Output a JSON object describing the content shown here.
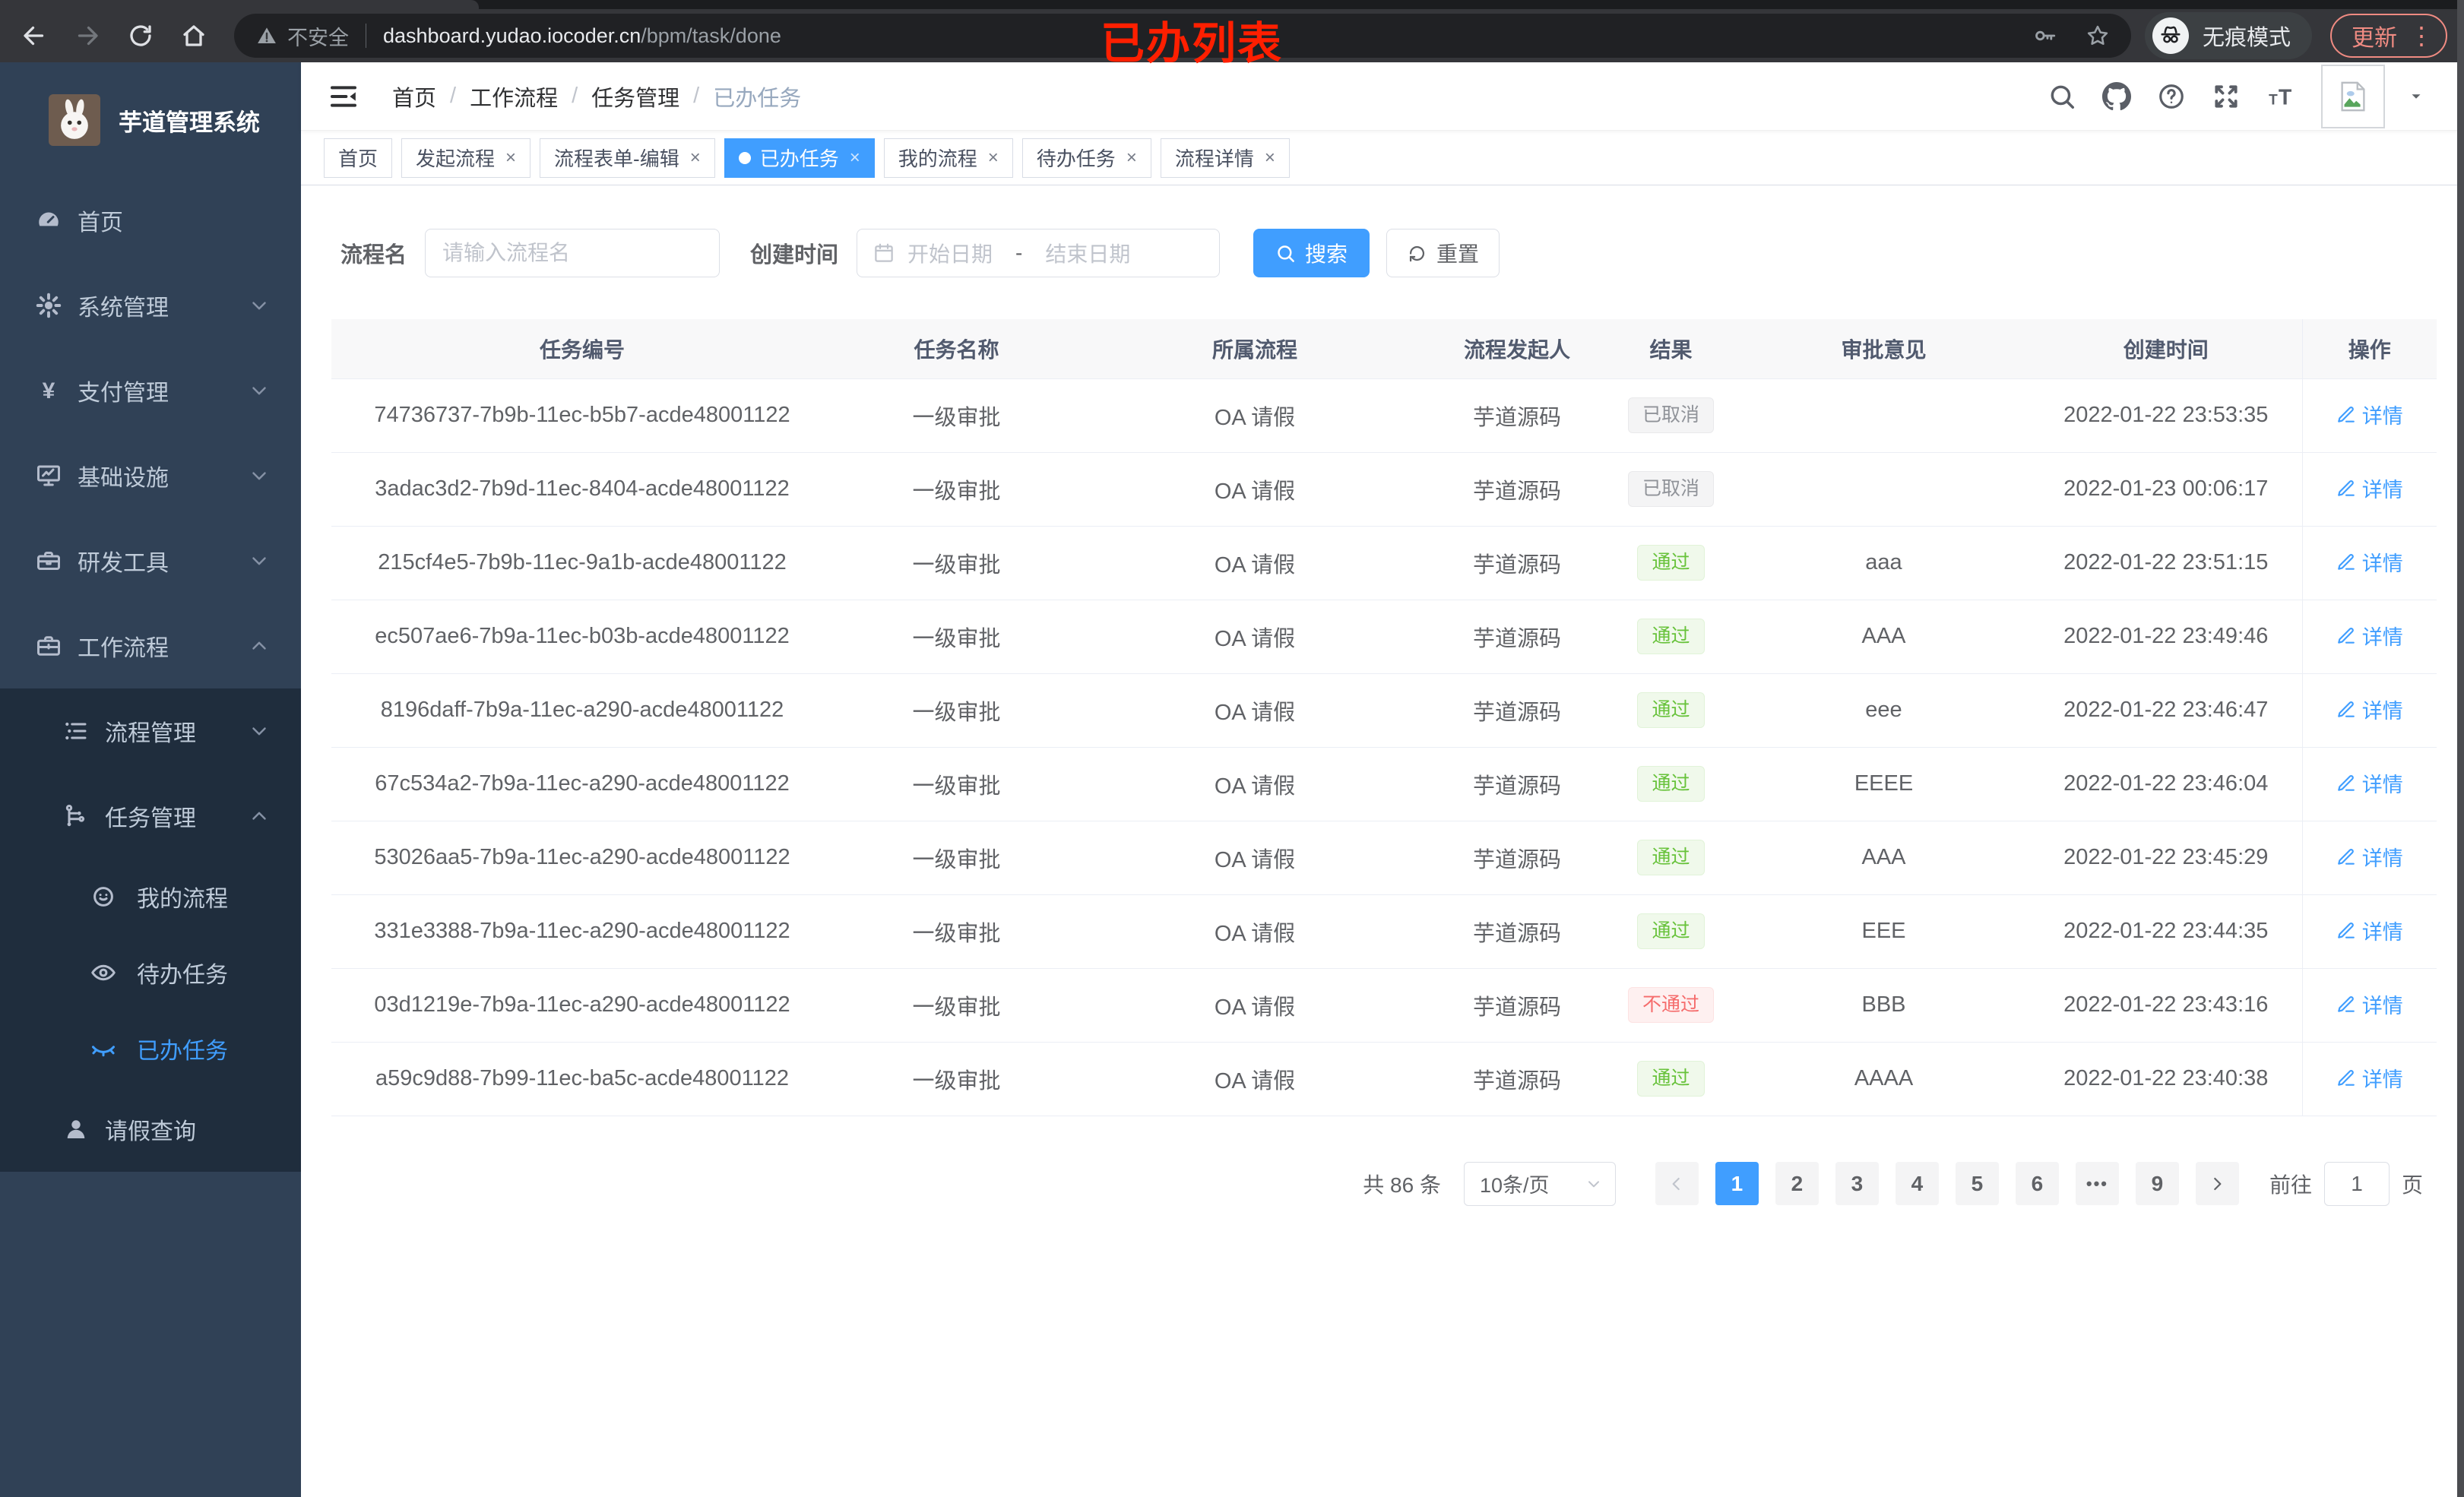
{
  "browser": {
    "security_label": "不安全",
    "url_host": "dashboard.yudao.iocoder.cn",
    "url_path": "/bpm/task/done",
    "incognito_label": "无痕模式",
    "update_label": "更新",
    "overlay_title": "已办列表"
  },
  "sidebar": {
    "logo_title": "芋道管理系统",
    "items": [
      {
        "key": "home",
        "icon": "dashboard-icon",
        "label": "首页",
        "level": 1
      },
      {
        "key": "system-management",
        "icon": "gear-icon",
        "label": "系统管理",
        "level": 1,
        "chevron": "down"
      },
      {
        "key": "payment-management",
        "icon": "yen-icon",
        "label": "支付管理",
        "level": 1,
        "chevron": "down"
      },
      {
        "key": "infrastructure",
        "icon": "monitor-icon",
        "label": "基础设施",
        "level": 1,
        "chevron": "down"
      },
      {
        "key": "dev-tools",
        "icon": "toolbox-icon",
        "label": "研发工具",
        "level": 1,
        "chevron": "down"
      },
      {
        "key": "workflow",
        "icon": "briefcase-icon",
        "label": "工作流程",
        "level": 1,
        "chevron": "up"
      },
      {
        "key": "process-management",
        "icon": "list-tree-icon",
        "label": "流程管理",
        "level": 2,
        "chevron": "down",
        "dark": true
      },
      {
        "key": "task-management",
        "icon": "flow-icon",
        "label": "任务管理",
        "level": 2,
        "chevron": "up",
        "dark": true
      },
      {
        "key": "my-process",
        "icon": "robot-icon",
        "label": "我的流程",
        "level": 3,
        "dark": true
      },
      {
        "key": "todo-tasks",
        "icon": "eye-icon",
        "label": "待办任务",
        "level": 3,
        "dark": true
      },
      {
        "key": "done-tasks",
        "icon": "eye-closed-icon",
        "label": "已办任务",
        "level": 3,
        "dark": true,
        "active": true
      },
      {
        "key": "leave-query",
        "icon": "user-icon",
        "label": "请假查询",
        "level": 2,
        "dark": true
      }
    ]
  },
  "header": {
    "breadcrumb": [
      "首页",
      "工作流程",
      "任务管理",
      "已办任务"
    ]
  },
  "tabs": [
    {
      "key": "home",
      "label": "首页"
    },
    {
      "key": "start-process",
      "label": "发起流程",
      "closable": true
    },
    {
      "key": "process-form-edit",
      "label": "流程表单-编辑",
      "closable": true
    },
    {
      "key": "done-tasks",
      "label": "已办任务",
      "closable": true,
      "active": true
    },
    {
      "key": "my-process",
      "label": "我的流程",
      "closable": true
    },
    {
      "key": "todo-tasks",
      "label": "待办任务",
      "closable": true
    },
    {
      "key": "process-detail",
      "label": "流程详情",
      "closable": true
    }
  ],
  "filters": {
    "process_name_label": "流程名",
    "process_name_placeholder": "请输入流程名",
    "created_label": "创建时间",
    "date_start_placeholder": "开始日期",
    "date_separator": "-",
    "date_end_placeholder": "结束日期",
    "search_label": "搜索",
    "reset_label": "重置"
  },
  "table": {
    "columns": [
      "任务编号",
      "任务名称",
      "所属流程",
      "流程发起人",
      "结果",
      "审批意见",
      "创建时间",
      "操作"
    ],
    "action_label": "详情",
    "rows": [
      {
        "id": "74736737-7b9b-11ec-b5b7-acde48001122",
        "name": "一级审批",
        "process": "OA 请假",
        "starter": "芋道源码",
        "result": "已取消",
        "result_type": "cancel",
        "opinion": "",
        "time": "2022-01-22 23:53:35"
      },
      {
        "id": "3adac3d2-7b9d-11ec-8404-acde48001122",
        "name": "一级审批",
        "process": "OA 请假",
        "starter": "芋道源码",
        "result": "已取消",
        "result_type": "cancel",
        "opinion": "",
        "time": "2022-01-23 00:06:17"
      },
      {
        "id": "215cf4e5-7b9b-11ec-9a1b-acde48001122",
        "name": "一级审批",
        "process": "OA 请假",
        "starter": "芋道源码",
        "result": "通过",
        "result_type": "pass",
        "opinion": "aaa",
        "time": "2022-01-22 23:51:15"
      },
      {
        "id": "ec507ae6-7b9a-11ec-b03b-acde48001122",
        "name": "一级审批",
        "process": "OA 请假",
        "starter": "芋道源码",
        "result": "通过",
        "result_type": "pass",
        "opinion": "AAA",
        "time": "2022-01-22 23:49:46"
      },
      {
        "id": "8196daff-7b9a-11ec-a290-acde48001122",
        "name": "一级审批",
        "process": "OA 请假",
        "starter": "芋道源码",
        "result": "通过",
        "result_type": "pass",
        "opinion": "eee",
        "time": "2022-01-22 23:46:47"
      },
      {
        "id": "67c534a2-7b9a-11ec-a290-acde48001122",
        "name": "一级审批",
        "process": "OA 请假",
        "starter": "芋道源码",
        "result": "通过",
        "result_type": "pass",
        "opinion": "EEEE",
        "time": "2022-01-22 23:46:04"
      },
      {
        "id": "53026aa5-7b9a-11ec-a290-acde48001122",
        "name": "一级审批",
        "process": "OA 请假",
        "starter": "芋道源码",
        "result": "通过",
        "result_type": "pass",
        "opinion": "AAA",
        "time": "2022-01-22 23:45:29"
      },
      {
        "id": "331e3388-7b9a-11ec-a290-acde48001122",
        "name": "一级审批",
        "process": "OA 请假",
        "starter": "芋道源码",
        "result": "通过",
        "result_type": "pass",
        "opinion": "EEE",
        "time": "2022-01-22 23:44:35"
      },
      {
        "id": "03d1219e-7b9a-11ec-a290-acde48001122",
        "name": "一级审批",
        "process": "OA 请假",
        "starter": "芋道源码",
        "result": "不通过",
        "result_type": "fail",
        "opinion": "BBB",
        "time": "2022-01-22 23:43:16"
      },
      {
        "id": "a59c9d88-7b99-11ec-ba5c-acde48001122",
        "name": "一级审批",
        "process": "OA 请假",
        "starter": "芋道源码",
        "result": "通过",
        "result_type": "pass",
        "opinion": "AAAA",
        "time": "2022-01-22 23:40:38"
      }
    ]
  },
  "pagination": {
    "total_label": "共 86 条",
    "page_size_value": "10条/页",
    "pages": [
      {
        "label": "1",
        "active": true
      },
      {
        "label": "2"
      },
      {
        "label": "3"
      },
      {
        "label": "4"
      },
      {
        "label": "5"
      },
      {
        "label": "6"
      },
      {
        "label": "•••",
        "more": true
      },
      {
        "label": "9"
      }
    ],
    "goto_label": "前往",
    "goto_value": "1",
    "page_unit": "页"
  },
  "colors": {
    "accent": "#409eff",
    "success": "#67c23a",
    "danger": "#f56c6c",
    "info": "#909399",
    "sidebar_bg": "#304156",
    "submenu_bg": "#1f2d3d",
    "update_badge": "#f08b82"
  }
}
